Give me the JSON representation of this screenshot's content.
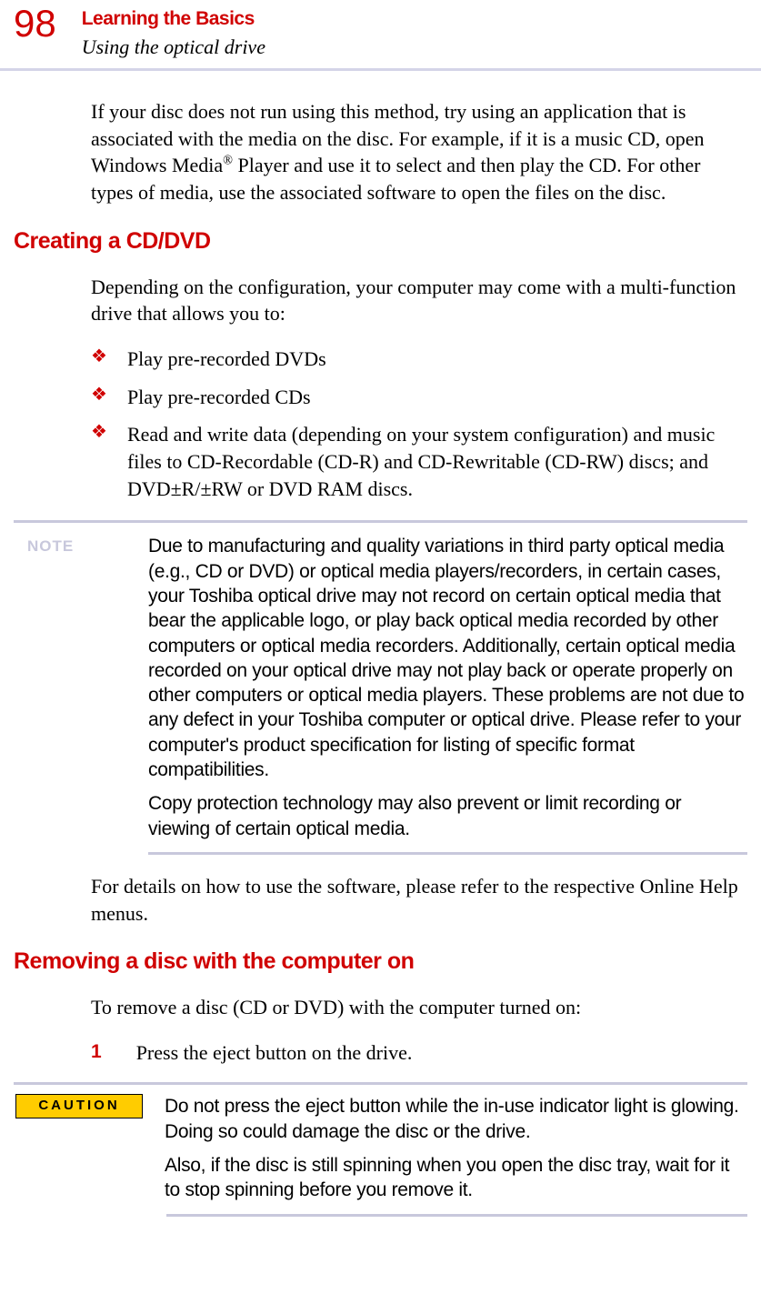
{
  "header": {
    "page_number": "98",
    "chapter": "Learning the Basics",
    "section": "Using the optical drive"
  },
  "intro_para": "If your disc does not run using this method, try using an application that is associated with the media on the disc. For example, if it is a music CD, open Windows Media® Player and use it to select and then play the CD. For other types of media, use the associated software to open the files on the disc.",
  "section1": {
    "heading": "Creating a CD/DVD",
    "para": "Depending on the configuration, your computer may come with a multi-function drive that allows you to:",
    "bullets": [
      "Play pre-recorded DVDs",
      "Play pre-recorded CDs",
      "Read and write data (depending on your system configuration) and music files to CD-Recordable (CD-R) and CD-Rewritable (CD-RW) discs; and DVD±R/±RW or DVD RAM discs."
    ]
  },
  "note": {
    "label": "NOTE",
    "p1": "Due to manufacturing and quality variations in third party optical media (e.g., CD or DVD) or optical media players/recorders, in certain cases, your Toshiba optical drive may not record on certain optical media that bear the applicable logo, or play back optical media recorded by other computers or optical media recorders. Additionally, certain optical media recorded on your optical drive may not play back or operate properly on other computers or optical media players. These problems are not due to any defect in your Toshiba computer or optical drive. Please refer to your computer's product specification for listing of specific format compatibilities.",
    "p2": "Copy protection technology may also prevent or limit recording or viewing of certain optical media."
  },
  "post_note_para": "For details on how to use the software, please refer to the respective Online Help menus.",
  "section2": {
    "heading": "Removing a disc with the computer on",
    "para": "To remove a disc (CD or DVD) with the computer turned on:",
    "step_num": "1",
    "step_text": "Press the eject button on the drive."
  },
  "caution": {
    "label": "CAUTION",
    "p1": "Do not press the eject button while the in-use indicator light is glowing. Doing so could damage the disc or the drive.",
    "p2": "Also, if the disc is still spinning when you open the disc tray, wait for it to stop spinning before you remove it."
  }
}
